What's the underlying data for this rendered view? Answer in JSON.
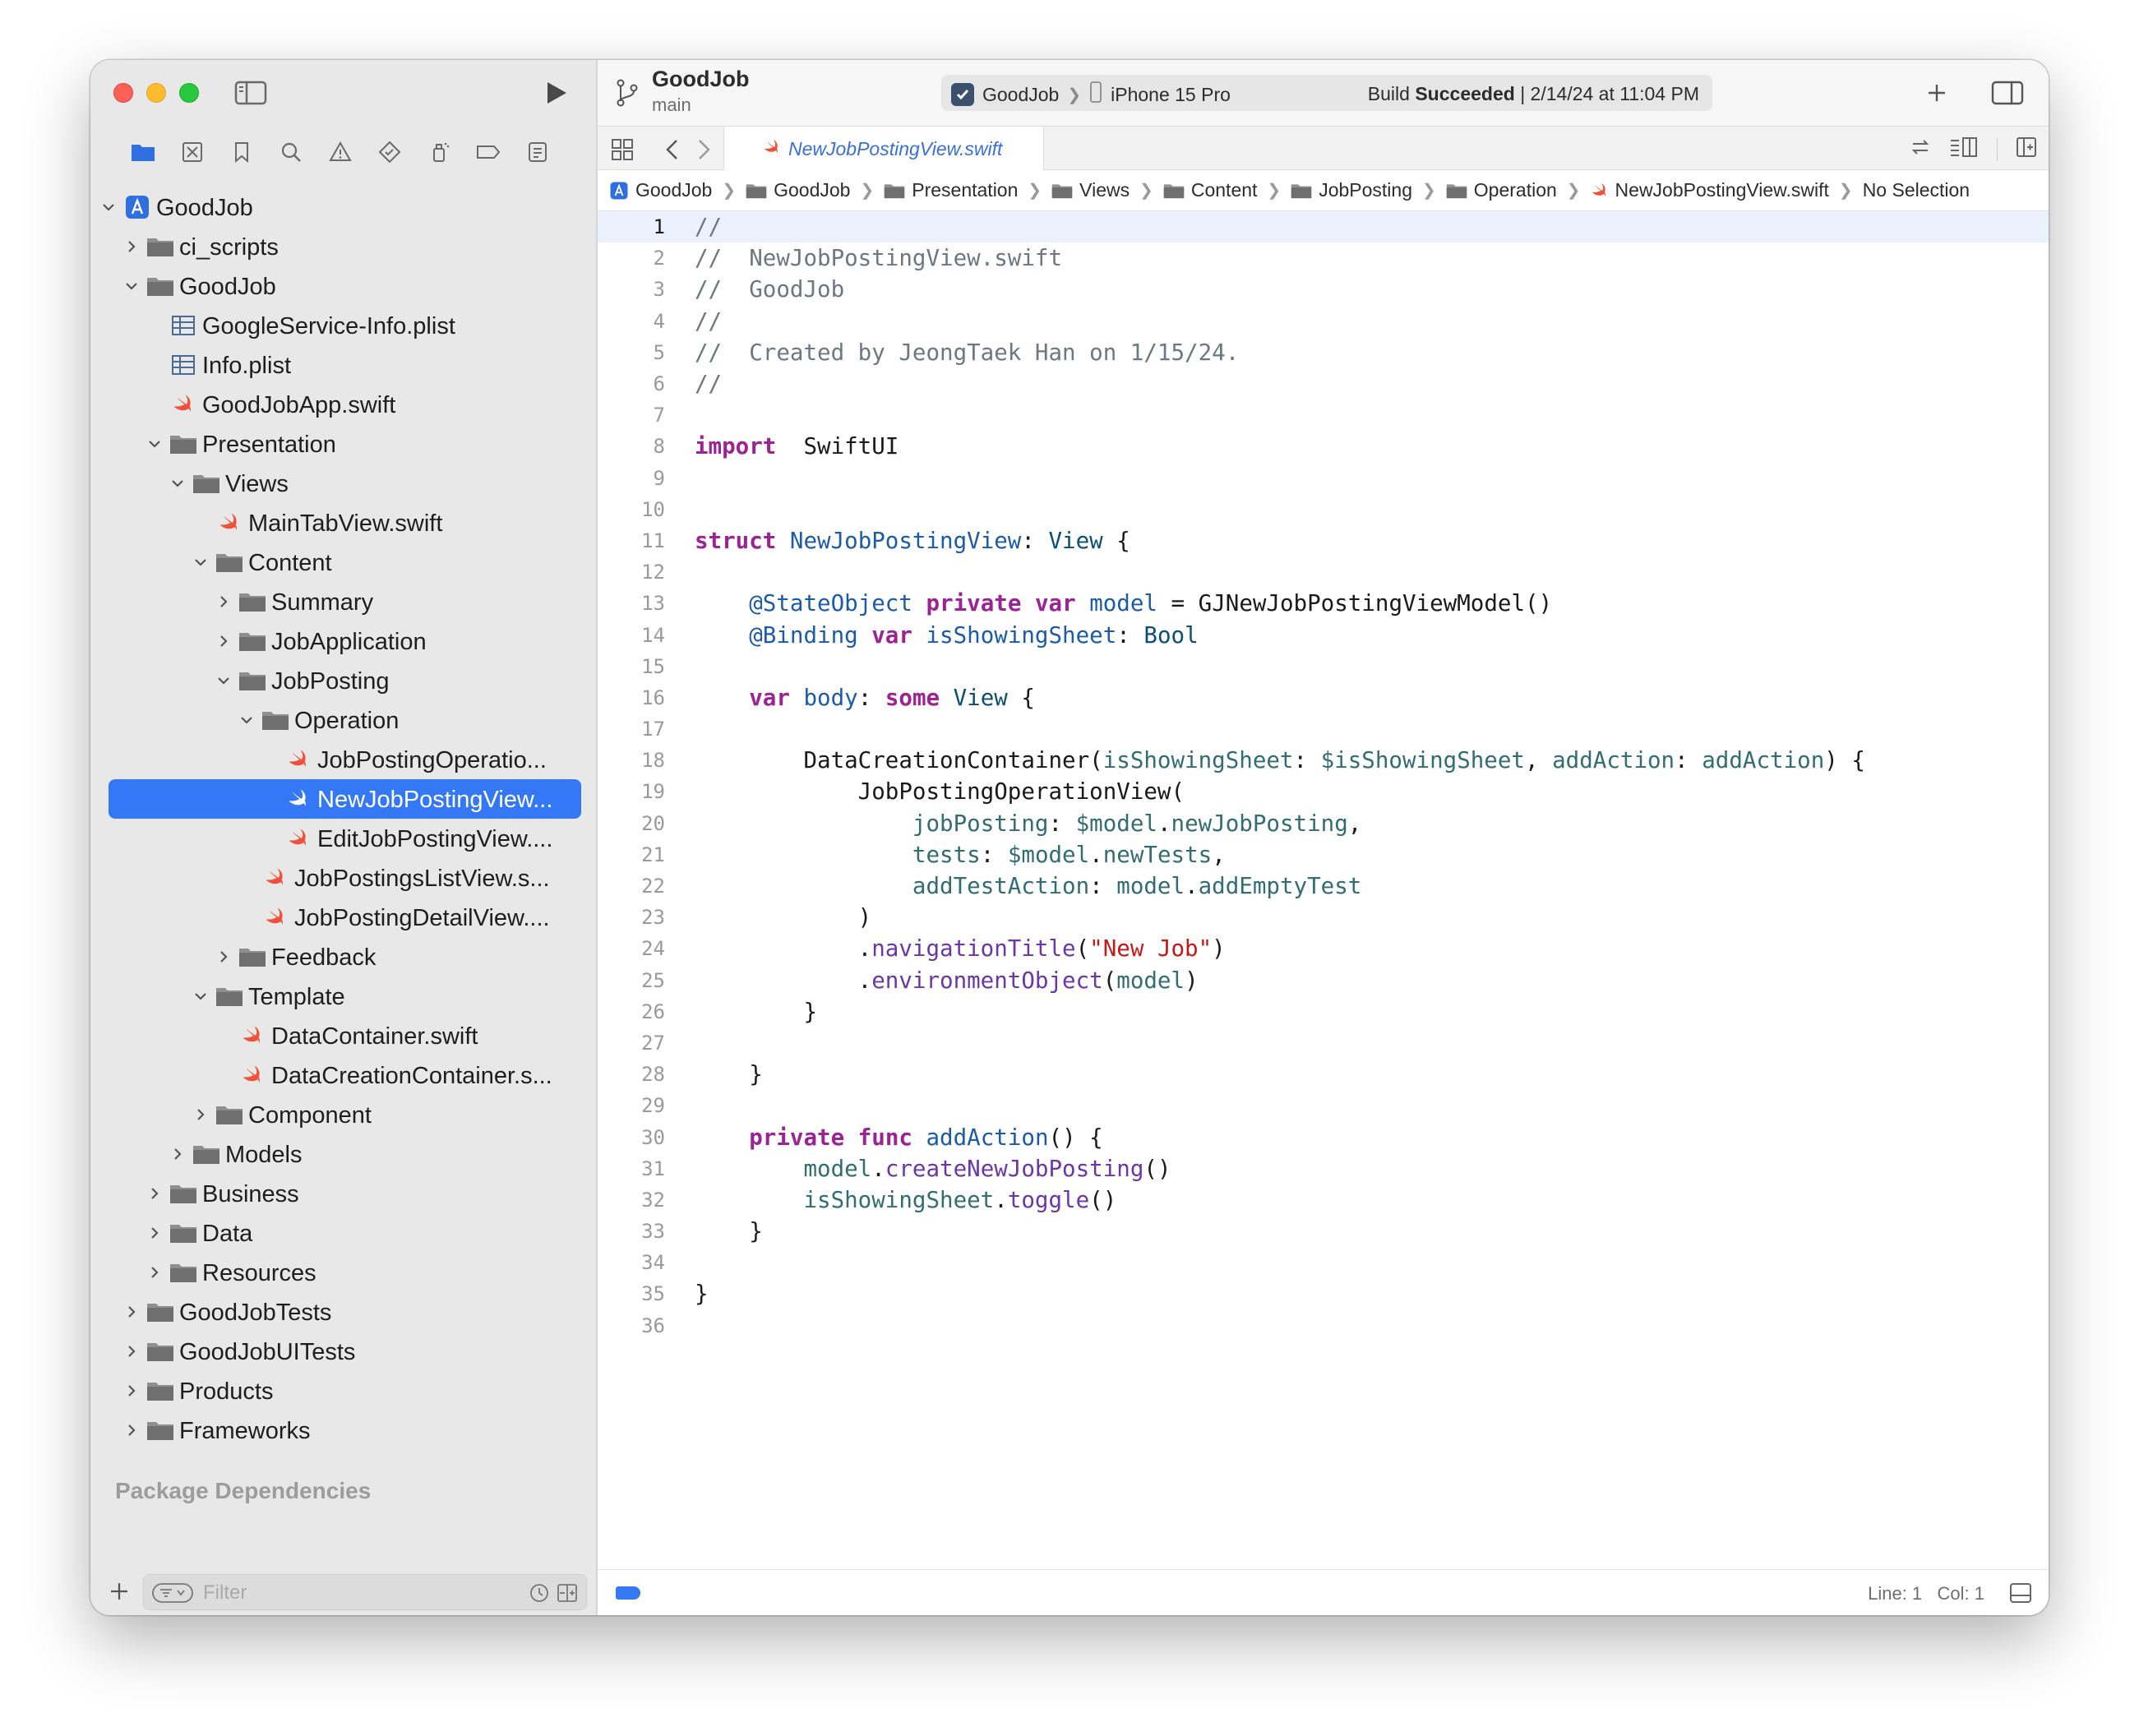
{
  "project": {
    "name": "GoodJob",
    "branch": "main"
  },
  "scheme": {
    "target": "GoodJob",
    "device": "iPhone 15 Pro"
  },
  "build_status": {
    "label": "Build",
    "result": "Succeeded",
    "timestamp": "| 2/14/24 at 11:04 PM"
  },
  "open_tab": {
    "label": "NewJobPostingView.swift"
  },
  "jump_bar": [
    "GoodJob",
    "GoodJob",
    "Presentation",
    "Views",
    "Content",
    "JobPosting",
    "Operation",
    "NewJobPostingView.swift",
    "No Selection"
  ],
  "tree": [
    {
      "label": "GoodJob",
      "depth": 0,
      "chev": "down",
      "icon": "project"
    },
    {
      "label": "ci_scripts",
      "depth": 1,
      "chev": "right",
      "icon": "folder"
    },
    {
      "label": "GoodJob",
      "depth": 1,
      "chev": "down",
      "icon": "folder"
    },
    {
      "label": "GoogleService-Info.plist",
      "depth": 2,
      "chev": "",
      "icon": "plist"
    },
    {
      "label": "Info.plist",
      "depth": 2,
      "chev": "",
      "icon": "plist"
    },
    {
      "label": "GoodJobApp.swift",
      "depth": 2,
      "chev": "",
      "icon": "swift"
    },
    {
      "label": "Presentation",
      "depth": 2,
      "chev": "down",
      "icon": "folder"
    },
    {
      "label": "Views",
      "depth": 3,
      "chev": "down",
      "icon": "folder"
    },
    {
      "label": "MainTabView.swift",
      "depth": 4,
      "chev": "",
      "icon": "swift"
    },
    {
      "label": "Content",
      "depth": 4,
      "chev": "down",
      "icon": "folder"
    },
    {
      "label": "Summary",
      "depth": 5,
      "chev": "right",
      "icon": "folder"
    },
    {
      "label": "JobApplication",
      "depth": 5,
      "chev": "right",
      "icon": "folder"
    },
    {
      "label": "JobPosting",
      "depth": 5,
      "chev": "down",
      "icon": "folder"
    },
    {
      "label": "Operation",
      "depth": 6,
      "chev": "down",
      "icon": "folder"
    },
    {
      "label": "JobPostingOperatio...",
      "depth": 7,
      "chev": "",
      "icon": "swift"
    },
    {
      "label": "NewJobPostingView...",
      "depth": 7,
      "chev": "",
      "icon": "swift",
      "selected": true
    },
    {
      "label": "EditJobPostingView....",
      "depth": 7,
      "chev": "",
      "icon": "swift"
    },
    {
      "label": "JobPostingsListView.s...",
      "depth": 6,
      "chev": "",
      "icon": "swift"
    },
    {
      "label": "JobPostingDetailView....",
      "depth": 6,
      "chev": "",
      "icon": "swift"
    },
    {
      "label": "Feedback",
      "depth": 5,
      "chev": "right",
      "icon": "folder"
    },
    {
      "label": "Template",
      "depth": 4,
      "chev": "down",
      "icon": "folder"
    },
    {
      "label": "DataContainer.swift",
      "depth": 5,
      "chev": "",
      "icon": "swift"
    },
    {
      "label": "DataCreationContainer.s...",
      "depth": 5,
      "chev": "",
      "icon": "swift"
    },
    {
      "label": "Component",
      "depth": 4,
      "chev": "right",
      "icon": "folder"
    },
    {
      "label": "Models",
      "depth": 3,
      "chev": "right",
      "icon": "folder"
    },
    {
      "label": "Business",
      "depth": 2,
      "chev": "right",
      "icon": "folder"
    },
    {
      "label": "Data",
      "depth": 2,
      "chev": "right",
      "icon": "folder"
    },
    {
      "label": "Resources",
      "depth": 2,
      "chev": "right",
      "icon": "folder"
    },
    {
      "label": "GoodJobTests",
      "depth": 1,
      "chev": "right",
      "icon": "folder"
    },
    {
      "label": "GoodJobUITests",
      "depth": 1,
      "chev": "right",
      "icon": "folder"
    },
    {
      "label": "Products",
      "depth": 1,
      "chev": "right",
      "icon": "folder"
    },
    {
      "label": "Frameworks",
      "depth": 1,
      "chev": "right",
      "icon": "folder"
    }
  ],
  "package_dependencies": "Package Dependencies",
  "filter": {
    "placeholder": "Filter"
  },
  "cursor": {
    "line_label": "Line: 1",
    "col_label": "Col: 1"
  },
  "code": [
    [
      [
        "cm",
        "//"
      ]
    ],
    [
      [
        "cm",
        "//  NewJobPostingView.swift"
      ]
    ],
    [
      [
        "cm",
        "//  GoodJob"
      ]
    ],
    [
      [
        "cm",
        "//"
      ]
    ],
    [
      [
        "cm",
        "//  Created by JeongTaek Han on 1/15/24."
      ]
    ],
    [
      [
        "cm",
        "//"
      ]
    ],
    [],
    [
      [
        "kw",
        "import"
      ],
      [
        "",
        "  SwiftUI"
      ]
    ],
    [],
    [],
    [
      [
        "kw",
        "struct"
      ],
      [
        "",
        " "
      ],
      [
        "ty",
        "NewJobPostingView"
      ],
      [
        "",
        ": "
      ],
      [
        "tb",
        "View"
      ],
      [
        "",
        " {"
      ]
    ],
    [],
    [
      [
        "",
        "    "
      ],
      [
        "at",
        "@StateObject"
      ],
      [
        "",
        " "
      ],
      [
        "kw",
        "private"
      ],
      [
        "",
        " "
      ],
      [
        "kw",
        "var"
      ],
      [
        "",
        " "
      ],
      [
        "ty",
        "model"
      ],
      [
        "",
        " = GJNewJobPostingViewModel()"
      ]
    ],
    [
      [
        "",
        "    "
      ],
      [
        "at",
        "@Binding"
      ],
      [
        "",
        " "
      ],
      [
        "kw",
        "var"
      ],
      [
        "",
        " "
      ],
      [
        "ty",
        "isShowingSheet"
      ],
      [
        "",
        ": "
      ],
      [
        "tb",
        "Bool"
      ]
    ],
    [],
    [
      [
        "",
        "    "
      ],
      [
        "kw",
        "var"
      ],
      [
        "",
        " "
      ],
      [
        "ty",
        "body"
      ],
      [
        "",
        ": "
      ],
      [
        "kw",
        "some"
      ],
      [
        "",
        " "
      ],
      [
        "tb",
        "View"
      ],
      [
        "",
        " {"
      ]
    ],
    [],
    [
      [
        "",
        "        DataCreationContainer("
      ],
      [
        "id",
        "isShowingSheet"
      ],
      [
        "",
        ": "
      ],
      [
        "id",
        "$isShowingSheet"
      ],
      [
        "",
        ", "
      ],
      [
        "id",
        "addAction"
      ],
      [
        "",
        ": "
      ],
      [
        "id",
        "addAction"
      ],
      [
        "",
        ") {"
      ]
    ],
    [
      [
        "",
        "            JobPostingOperationView("
      ]
    ],
    [
      [
        "",
        "                "
      ],
      [
        "id",
        "jobPosting"
      ],
      [
        "",
        ": "
      ],
      [
        "id",
        "$model"
      ],
      [
        "",
        "."
      ],
      [
        "id",
        "newJobPosting"
      ],
      [
        "",
        ","
      ]
    ],
    [
      [
        "",
        "                "
      ],
      [
        "id",
        "tests"
      ],
      [
        "",
        ": "
      ],
      [
        "id",
        "$model"
      ],
      [
        "",
        "."
      ],
      [
        "id",
        "newTests"
      ],
      [
        "",
        ","
      ]
    ],
    [
      [
        "",
        "                "
      ],
      [
        "id",
        "addTestAction"
      ],
      [
        "",
        ": "
      ],
      [
        "id",
        "model"
      ],
      [
        "",
        "."
      ],
      [
        "id",
        "addEmptyTest"
      ]
    ],
    [
      [
        "",
        "            )"
      ]
    ],
    [
      [
        "",
        "            ."
      ],
      [
        "fn",
        "navigationTitle"
      ],
      [
        "",
        "("
      ],
      [
        "st",
        "\"New Job\""
      ],
      [
        "",
        ")"
      ]
    ],
    [
      [
        "",
        "            ."
      ],
      [
        "fn",
        "environmentObject"
      ],
      [
        "",
        "("
      ],
      [
        "id",
        "model"
      ],
      [
        "",
        ")"
      ]
    ],
    [
      [
        "",
        "        }"
      ]
    ],
    [],
    [
      [
        "",
        "    }"
      ]
    ],
    [],
    [
      [
        "",
        "    "
      ],
      [
        "kw",
        "private"
      ],
      [
        "",
        " "
      ],
      [
        "kw",
        "func"
      ],
      [
        "",
        " "
      ],
      [
        "ty",
        "addAction"
      ],
      [
        "",
        "() {"
      ]
    ],
    [
      [
        "",
        "        "
      ],
      [
        "id",
        "model"
      ],
      [
        "",
        "."
      ],
      [
        "fn",
        "createNewJobPosting"
      ],
      [
        "",
        "()"
      ]
    ],
    [
      [
        "",
        "        "
      ],
      [
        "id",
        "isShowingSheet"
      ],
      [
        "",
        "."
      ],
      [
        "fn",
        "toggle"
      ],
      [
        "",
        "()"
      ]
    ],
    [
      [
        "",
        "    }"
      ]
    ],
    [],
    [
      [
        "",
        "}"
      ]
    ],
    []
  ]
}
